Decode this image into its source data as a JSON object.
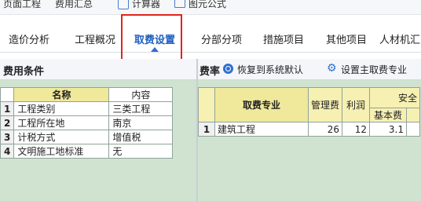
{
  "toolbar": {
    "item1": "页面工程",
    "item2": "费用汇总",
    "calculator": "计算器",
    "formula": "图元公式"
  },
  "tabs": [
    {
      "label": "造价分析"
    },
    {
      "label": "工程概况"
    },
    {
      "label": "取费设置"
    },
    {
      "label": "分部分项"
    },
    {
      "label": "措施项目"
    },
    {
      "label": "其他项目"
    },
    {
      "label": "人材机汇"
    }
  ],
  "left": {
    "title": "费用条件",
    "headers": {
      "name": "名称",
      "content": "内容"
    },
    "rows": [
      {
        "idx": "1",
        "name": "工程类别",
        "value": "三类工程"
      },
      {
        "idx": "2",
        "name": "工程所在地",
        "value": "南京"
      },
      {
        "idx": "3",
        "name": "计税方式",
        "value": "增值税"
      },
      {
        "idx": "4",
        "name": "文明施工地标准",
        "value": "无"
      }
    ]
  },
  "right": {
    "title": "费率",
    "restore_label": "恢复到系统默认",
    "set_main_label": "设置主取费专业",
    "headers": {
      "specialty": "取费专业",
      "mgmt": "管理费",
      "profit": "利润",
      "safety": "安全",
      "base": "基本费"
    },
    "rows": [
      {
        "idx": "1",
        "specialty": "建筑工程",
        "mgmt": "26",
        "profit": "12",
        "base": "3.1"
      }
    ]
  },
  "colors": {
    "accent": "#1f5fbf",
    "highlight_box": "#e2241c",
    "header_yellow": "#f0e89a",
    "panel_green": "#cfe3d0"
  }
}
